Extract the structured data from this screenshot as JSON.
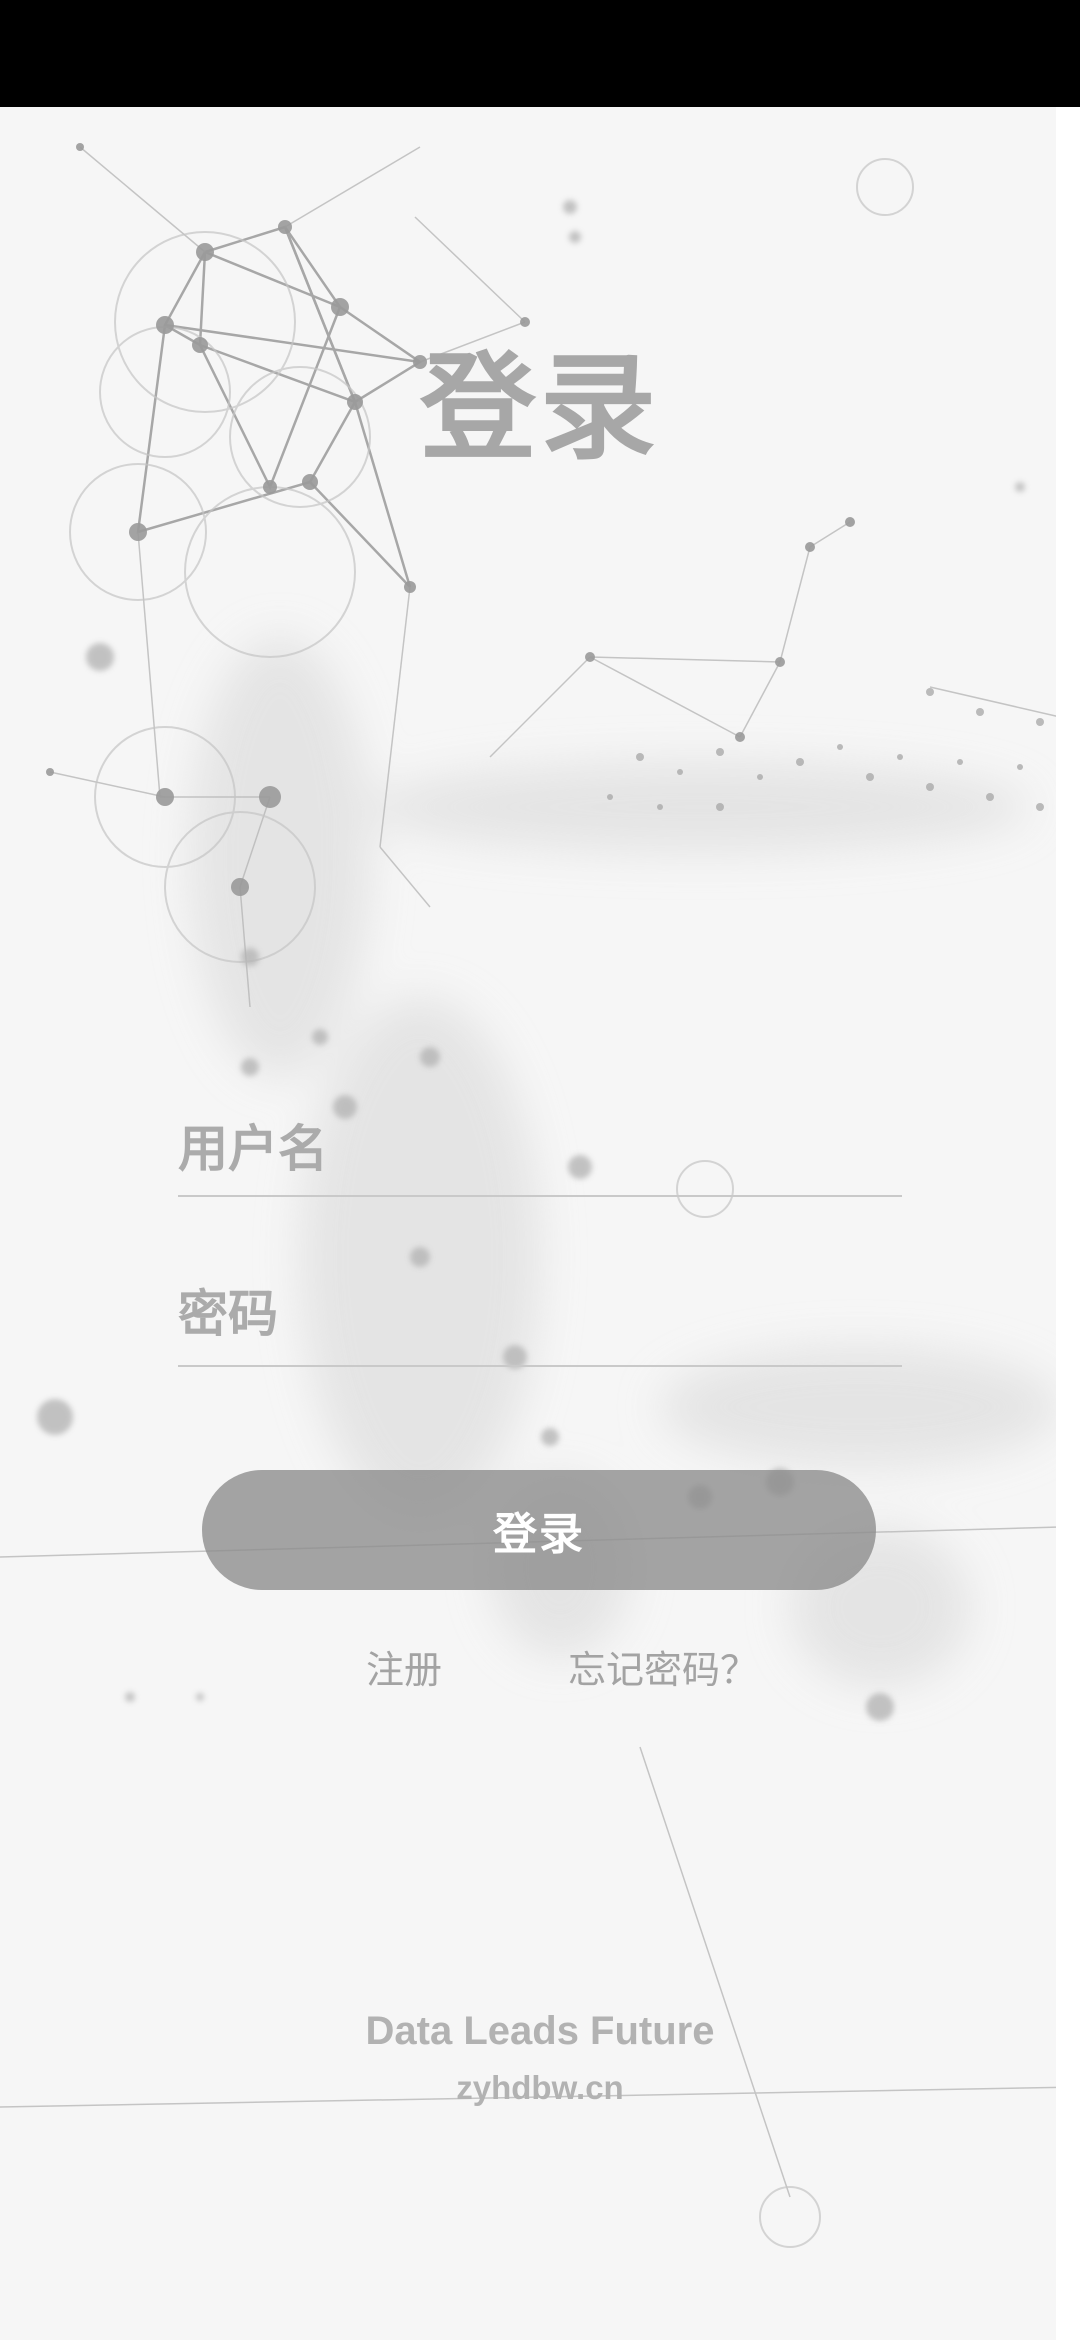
{
  "login": {
    "title": "登录",
    "username_placeholder": "用户名",
    "password_placeholder": "密码",
    "login_button": "登录",
    "register_link": "注册",
    "forgot_link": "忘记密码？"
  },
  "footer": {
    "slogan": "Data Leads Future",
    "site": "zyhdbw.cn"
  },
  "icons": {
    "background": "network-graph-background"
  },
  "colors": {
    "background": "#f6f6f6",
    "text_gray": "#a7a7a7",
    "button_gray": "#8c8c8c",
    "status_bar": "#000000"
  }
}
